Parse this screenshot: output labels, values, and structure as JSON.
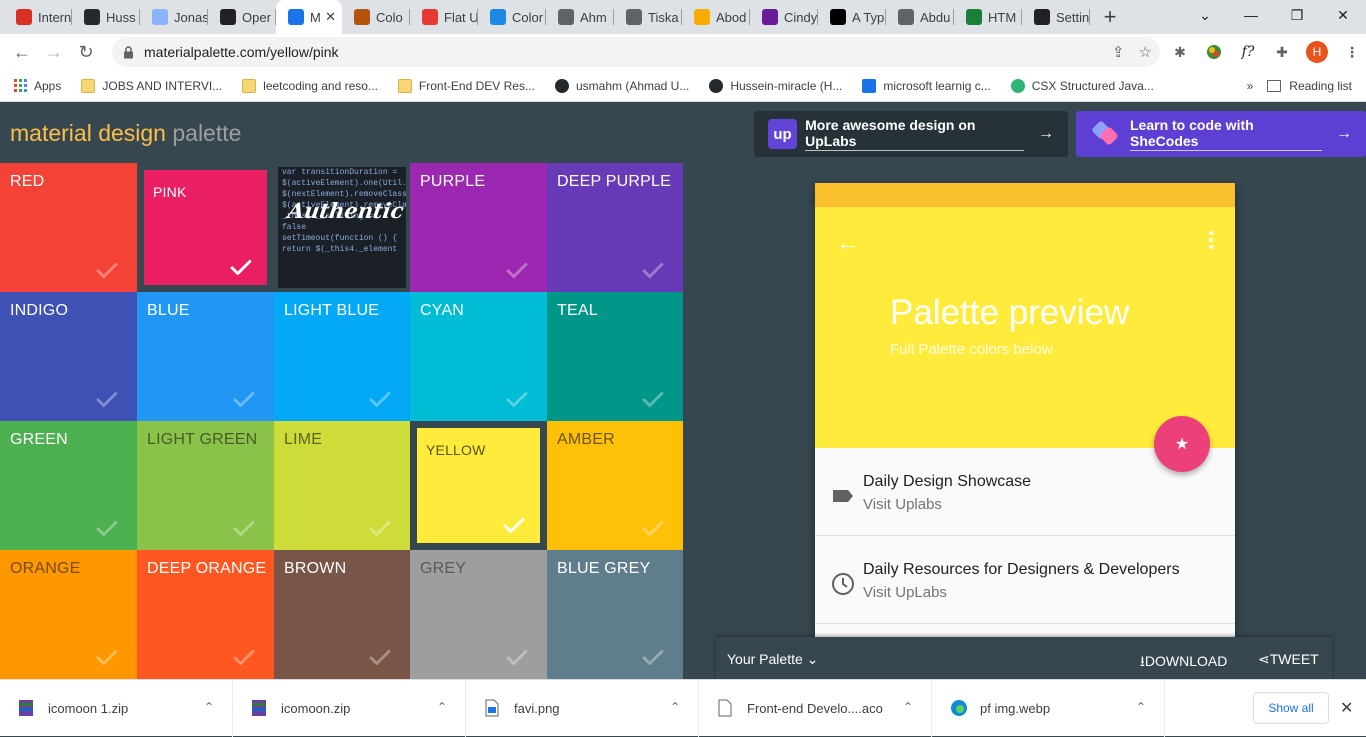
{
  "browser": {
    "tabs": [
      {
        "label": "Intern",
        "icon": "wave-icon",
        "color": "#d93025"
      },
      {
        "label": "Huss",
        "icon": "github-icon",
        "color": "#24292e"
      },
      {
        "label": "Jonas",
        "icon": "diamond-icon",
        "color": "#8ab4f8"
      },
      {
        "label": "Oper",
        "icon": "oc-icon",
        "color": "#202124"
      },
      {
        "label": "M",
        "icon": "material-icon",
        "color": "#1a73e8"
      },
      {
        "label": "Colo",
        "icon": "shield-icon",
        "color": "#b45309"
      },
      {
        "label": "Flat U",
        "icon": "flat-icon",
        "color": "#e53935"
      },
      {
        "label": "Color",
        "icon": "c-icon",
        "color": "#1e88e5"
      },
      {
        "label": "Ahm",
        "icon": "person-icon",
        "color": "#5f6368"
      },
      {
        "label": "Tiska",
        "icon": "tiska-icon",
        "color": "#5f6368"
      },
      {
        "label": "Abod",
        "icon": "abod-icon",
        "color": "#f9ab00"
      },
      {
        "label": "Cindy",
        "icon": "cc-icon",
        "color": "#6a1b9a"
      },
      {
        "label": "A Typ",
        "icon": "dev-icon",
        "color": "#000000"
      },
      {
        "label": "Abdu",
        "icon": "globe-icon",
        "color": "#5f6368"
      },
      {
        "label": "HTM",
        "icon": "question-icon",
        "color": "#188038"
      },
      {
        "label": "Settin",
        "icon": "check-circle-icon",
        "color": "#202124"
      }
    ],
    "url": "materialpalette.com/yellow/pink",
    "avatar_letter": "H",
    "bookmarks": [
      {
        "label": "Apps",
        "icon": "apps-icon"
      },
      {
        "label": "JOBS AND INTERVI...",
        "icon": "folder-icon"
      },
      {
        "label": "leetcoding and reso...",
        "icon": "folder-icon"
      },
      {
        "label": "Front-End DEV Res...",
        "icon": "folder-icon"
      },
      {
        "label": "usmahm (Ahmad U...",
        "icon": "github-icon"
      },
      {
        "label": "Hussein-miracle (H...",
        "icon": "github-icon"
      },
      {
        "label": "microsoft learnig c...",
        "icon": "play-icon"
      },
      {
        "label": "CSX Structured Java...",
        "icon": "csx-icon"
      }
    ],
    "more_bookmarks": "»",
    "reading_list": "Reading list"
  },
  "header": {
    "logo_part1": "material design",
    "logo_part2": "palette",
    "promo_uplabs": "More awesome design on UpLabs",
    "promo_shecodes": "Learn to code with SheCodes"
  },
  "palette": [
    {
      "name": "RED",
      "color": "#f44336",
      "text": "#ffffff"
    },
    {
      "name": "PINK",
      "color": "#e91e63",
      "text": "#ffffff",
      "selected": true
    },
    {
      "name": "",
      "color": "#1b2026",
      "ad": true
    },
    {
      "name": "PURPLE",
      "color": "#9c27b0",
      "text": "#ffffff"
    },
    {
      "name": "DEEP PURPLE",
      "color": "#673ab7",
      "text": "#ffffff"
    },
    {
      "name": "INDIGO",
      "color": "#3f51b5",
      "text": "#ffffff"
    },
    {
      "name": "BLUE",
      "color": "#2196f3",
      "text": "#ffffff"
    },
    {
      "name": "LIGHT BLUE",
      "color": "#03a9f4",
      "text": "#ffffff"
    },
    {
      "name": "CYAN",
      "color": "#00bcd4",
      "text": "#ffffff"
    },
    {
      "name": "TEAL",
      "color": "#009688",
      "text": "#ffffff"
    },
    {
      "name": "GREEN",
      "color": "#4caf50",
      "text": "#ffffff"
    },
    {
      "name": "LIGHT GREEN",
      "color": "#8bc34a",
      "text": "#4a5a2a"
    },
    {
      "name": "LIME",
      "color": "#cddc39",
      "text": "#5a6420"
    },
    {
      "name": "YELLOW",
      "color": "#ffeb3b",
      "text": "#5a5420",
      "selected": true
    },
    {
      "name": "AMBER",
      "color": "#ffc107",
      "text": "#6a5410"
    },
    {
      "name": "ORANGE",
      "color": "#ff9800",
      "text": "#7a4a10"
    },
    {
      "name": "DEEP ORANGE",
      "color": "#ff5722",
      "text": "#ffffff"
    },
    {
      "name": "BROWN",
      "color": "#795548",
      "text": "#ffffff"
    },
    {
      "name": "GREY",
      "color": "#9e9e9e",
      "text": "#5a5a5a"
    },
    {
      "name": "BLUE GREY",
      "color": "#607d8b",
      "text": "#ffffff"
    }
  ],
  "ad": {
    "brand": "Authentic",
    "code_lines": [
      "var transitionDuration = ",
      "$(activeElement).one(Util.TR",
      " $(nextElement).removeClass",
      " $(activeElement).removeClass",
      " _this4._isSliding = false",
      "setTimeout(function () {",
      "  return $(_this4._element"
    ]
  },
  "preview": {
    "title": "Palette preview",
    "subtitle": "Full Palette colors below",
    "items": [
      {
        "title": "Daily Design Showcase",
        "subtitle": "Visit Uplabs",
        "icon": "label-icon"
      },
      {
        "title": "Daily Resources for Designers & Developers",
        "subtitle": "Visit UpLabs",
        "icon": "clock-icon"
      }
    ],
    "colors": {
      "primary": "#ffeb3b",
      "primary_dark": "#fbc02d",
      "accent": "#ec407a"
    }
  },
  "palette_bar": {
    "label": "Your Palette",
    "download": "DOWNLOAD",
    "tweet": "TWEET"
  },
  "downloads": {
    "items": [
      {
        "name": "icomoon 1.zip",
        "icon": "zip-icon"
      },
      {
        "name": "icomoon.zip",
        "icon": "zip-icon"
      },
      {
        "name": "favi.png",
        "icon": "image-icon"
      },
      {
        "name": "Front-end Develo....aco",
        "icon": "file-icon"
      },
      {
        "name": "pf img.webp",
        "icon": "edge-icon"
      }
    ],
    "show_all": "Show all"
  }
}
